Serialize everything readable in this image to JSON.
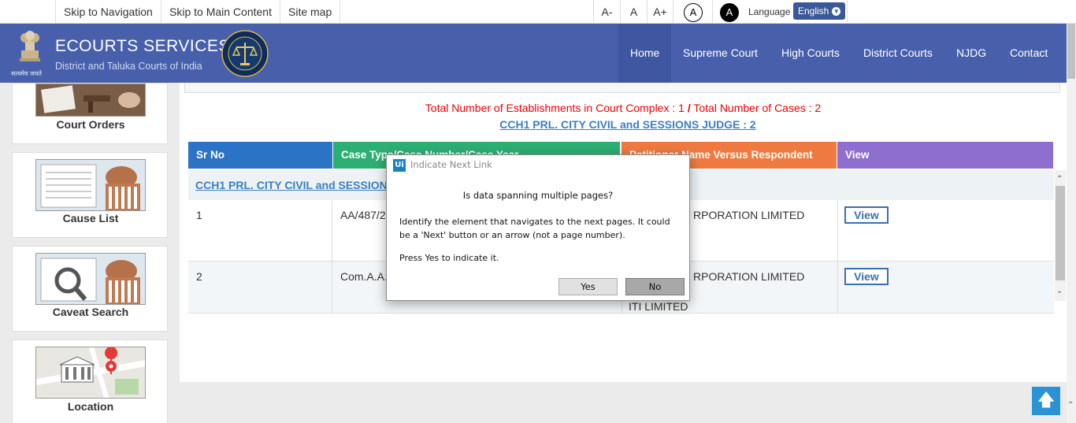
{
  "topbar": {
    "skip_nav": "Skip to Navigation",
    "skip_main": "Skip to Main Content",
    "sitemap": "Site map",
    "font_decrease": "A-",
    "font_normal": "A",
    "font_increase": "A+",
    "contrast_normal": "A",
    "contrast_dark": "A",
    "language_label": "Language",
    "language_value": "English"
  },
  "header": {
    "title": "ECOURTS SERVICES",
    "subtitle": "District and Taluka Courts of India",
    "emblem_caption": "सत्यमेव जयते",
    "nav": [
      "Home",
      "Supreme Court",
      "High Courts",
      "District Courts",
      "NJDG",
      "Contact Us"
    ]
  },
  "sidebar": {
    "items": [
      {
        "label": "Court Orders",
        "icon": "court-orders-icon"
      },
      {
        "label": "Cause List",
        "icon": "cause-list-icon"
      },
      {
        "label": "Caveat Search",
        "icon": "caveat-search-icon"
      },
      {
        "label": "Location",
        "icon": "location-icon"
      }
    ]
  },
  "summary": {
    "establishments_label": "Total Number of Establishments in Court Complex :",
    "establishments_value": "1",
    "sep": "/",
    "cases_label": "Total Number of Cases :",
    "cases_value": "2",
    "judge_link": "CCH1 PRL. CITY CIVIL and SESSIONS JUDGE : 2"
  },
  "table": {
    "headers": [
      "Sr No",
      "Case Type/Case Number/Case Year",
      "Petitioner Name Versus Respondent Name",
      "View"
    ],
    "header_colors": [
      "#2b73c4",
      "#2daf74",
      "#ee7a41",
      "#8e6fd0"
    ],
    "group_link": "CCH1 PRL. CITY CIVIL and SESSIONS JUDGE",
    "rows": [
      {
        "sr": "1",
        "case": "AA/487/20",
        "parties": "RPORATION LIMITED",
        "parties2": "",
        "view": "View"
      },
      {
        "sr": "2",
        "case": "Com.A.A.",
        "parties": "RPORATION LIMITED",
        "parties2": "ITI LIMITED",
        "view": "View"
      }
    ]
  },
  "dialog": {
    "icon_text": "Ui",
    "title": "Indicate Next Link",
    "question": "Is data spanning multiple pages?",
    "message": "Identify the element that navigates to the next pages. It could be a 'Next' button or an arrow (not a page number).",
    "press": "Press Yes to indicate it.",
    "yes": "Yes",
    "no": "No"
  },
  "back_to_top_icon": "arrow-up-icon"
}
